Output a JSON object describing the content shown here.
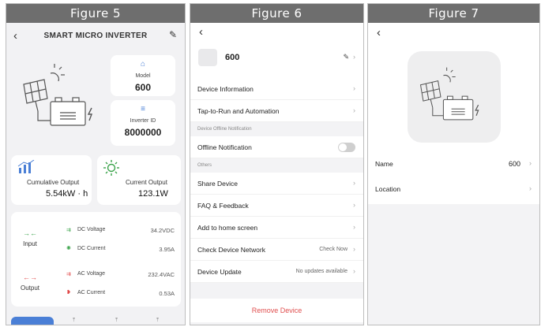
{
  "figures": {
    "fig5": "Figure 5",
    "fig6": "Figure 6",
    "fig7": "Figure 7"
  },
  "fig5": {
    "header_title": "SMART MICRO INVERTER",
    "model_label": "Model",
    "model_value": "600",
    "inverter_id_label": "Inverter ID",
    "inverter_id_value": "8000000",
    "cumulative_label": "Cumulative Output",
    "cumulative_value": "5.54kW · h",
    "current_label": "Current Output",
    "current_value": "123.1W",
    "input_label": "Input",
    "output_label": "Output",
    "dc_voltage_label": "DC Voltage",
    "dc_voltage_value": "34.2VDC",
    "dc_current_label": "DC Current",
    "dc_current_value": "3.95A",
    "ac_voltage_label": "AC Voltage",
    "ac_voltage_value": "232.4VAC",
    "ac_current_label": "AC Current",
    "ac_current_value": "0.53A",
    "accent": "#4a7fd6",
    "green": "#3aa34a",
    "red": "#e04848"
  },
  "fig6": {
    "device_name": "600",
    "rows_a": [
      {
        "label": "Device Information"
      },
      {
        "label": "Tap-to-Run and Automation"
      }
    ],
    "section_offline": "Device Offline Notification",
    "offline_label": "Offline Notification",
    "section_others": "Others",
    "rows_b": [
      {
        "label": "Share Device",
        "aux": ""
      },
      {
        "label": "FAQ & Feedback",
        "aux": ""
      },
      {
        "label": "Add to home screen",
        "aux": ""
      },
      {
        "label": "Check Device Network",
        "aux": "Check Now"
      },
      {
        "label": "Device Update",
        "aux": "No updates available"
      }
    ],
    "remove_label": "Remove Device"
  },
  "fig7": {
    "name_label": "Name",
    "name_value": "600",
    "location_label": "Location"
  },
  "icons": {
    "back": "‹",
    "chevron": "›",
    "edit": "✎"
  }
}
